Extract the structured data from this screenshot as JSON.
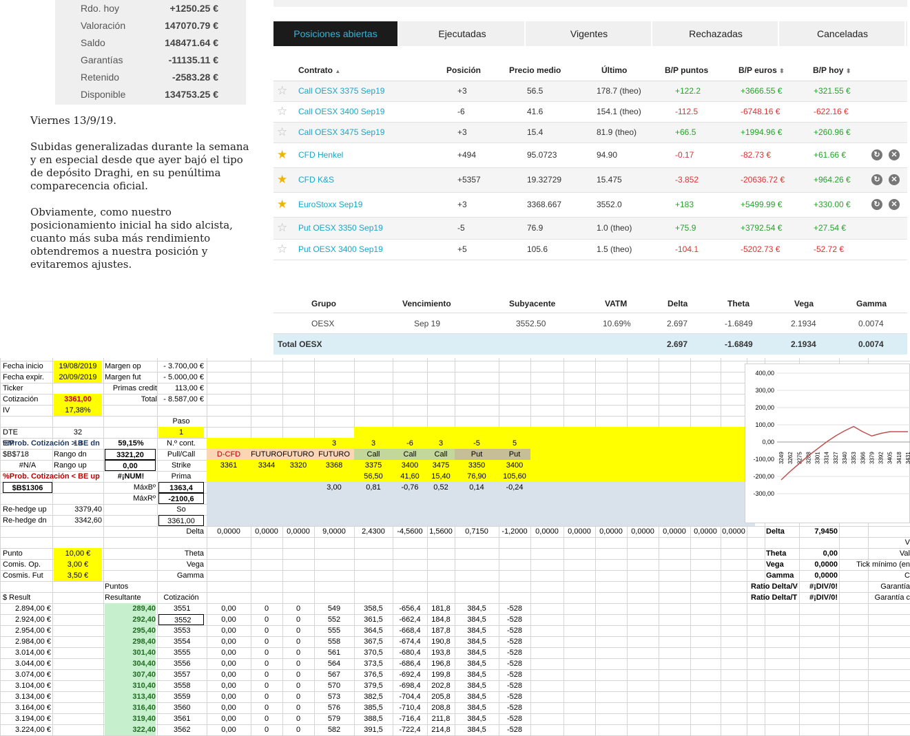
{
  "summary": [
    {
      "label": "Rdo. hoy",
      "value": "+1250.25 €"
    },
    {
      "label": "Valoración",
      "value": "147070.79 €"
    },
    {
      "label": "Saldo",
      "value": "148471.64 €"
    },
    {
      "label": "Garantías",
      "value": "-11135.11 €"
    },
    {
      "label": "Retenido",
      "value": "-2583.28 €"
    },
    {
      "label": "Disponible",
      "value": "134753.25 €"
    }
  ],
  "comment": {
    "p1": "Viernes 13/9/19.",
    "p2": "Subidas generalizadas durante la semana y en especial desde que ayer bajó el tipo de depósito Draghi, en su penúltima comparecencia oficial.",
    "p3": "Obviamente, como nuestro posicionamiento inicial ha sido alcista, cuanto más suba más rendimiento obtendremos a nuestra posición y evitaremos ajustes."
  },
  "tabs": [
    "Posiciones abiertas",
    "Ejecutadas",
    "Vigentes",
    "Rechazadas",
    "Canceladas"
  ],
  "positions": {
    "headers": {
      "contract": "Contrato",
      "position": "Posición",
      "avg": "Precio medio",
      "last": "Último",
      "bp_points": "B/P puntos",
      "bp_euros": "B/P euros",
      "bp_today": "B/P hoy"
    },
    "rows": [
      {
        "fav": false,
        "contract": "Call OESX 3375 Sep19",
        "position": "+3",
        "avg": "56.5",
        "last": "178.7 (theo)",
        "bp_points": "+122.2",
        "bp_euros": "+3666.55 €",
        "bp_today": "+321.55 €"
      },
      {
        "fav": false,
        "contract": "Call OESX 3400 Sep19",
        "position": "-6",
        "avg": "41.6",
        "last": "154.1 (theo)",
        "bp_points": "-112.5",
        "bp_euros": "-6748.16 €",
        "bp_today": "-622.16 €"
      },
      {
        "fav": false,
        "contract": "Call OESX 3475 Sep19",
        "position": "+3",
        "avg": "15.4",
        "last": "81.9 (theo)",
        "bp_points": "+66.5",
        "bp_euros": "+1994.96 €",
        "bp_today": "+260.96 €"
      },
      {
        "fav": true,
        "contract": "CFD Henkel",
        "position": "+494",
        "avg": "95.0723",
        "last": "94.90",
        "bp_points": "-0.17",
        "bp_euros": "-82.73 €",
        "bp_today": "+61.66 €"
      },
      {
        "fav": true,
        "contract": "CFD K&S",
        "position": "+5357",
        "avg": "19.32729",
        "last": "15.475",
        "bp_points": "-3.852",
        "bp_euros": "-20636.72 €",
        "bp_today": "+964.26 €"
      },
      {
        "fav": true,
        "contract": "EuroStoxx Sep19",
        "position": "+3",
        "avg": "3368.667",
        "last": "3552.0",
        "bp_points": "+183",
        "bp_euros": "+5499.99 €",
        "bp_today": "+330.00 €"
      },
      {
        "fav": false,
        "contract": "Put OESX 3350 Sep19",
        "position": "-5",
        "avg": "76.9",
        "last": "1.0 (theo)",
        "bp_points": "+75.9",
        "bp_euros": "+3792.54 €",
        "bp_today": "+27.54 €"
      },
      {
        "fav": false,
        "contract": "Put OESX 3400 Sep19",
        "position": "+5",
        "avg": "105.6",
        "last": "1.5 (theo)",
        "bp_points": "-104.1",
        "bp_euros": "-5202.73 €",
        "bp_today": "-52.72 €"
      }
    ]
  },
  "greeks": {
    "headers": {
      "group": "Grupo",
      "expiry": "Vencimiento",
      "underlying": "Subyacente",
      "vatm": "VATM",
      "delta": "Delta",
      "theta": "Theta",
      "vega": "Vega",
      "gamma": "Gamma"
    },
    "row": {
      "group": "OESX",
      "expiry": "Sep 19",
      "underlying": "3552.50",
      "vatm": "10.69%",
      "delta": "2.697",
      "theta": "-1.6849",
      "vega": "2.1934",
      "gamma": "0.0074"
    },
    "total": {
      "label": "Total OESX",
      "delta": "2.697",
      "theta": "-1.6849",
      "vega": "2.1934",
      "gamma": "0.0074"
    }
  },
  "sheet": {
    "left_labels": [
      {
        "label": "Fecha inicio",
        "value": "19/08/2019"
      },
      {
        "label": "Fecha expir.",
        "value": "20/09/2019"
      },
      {
        "label": "Ticker",
        "value": ""
      },
      {
        "label": "Cotización",
        "value": "3361,00"
      },
      {
        "label": "IV",
        "value": "17,38%"
      },
      {
        "label": "DTE",
        "value": "32"
      },
      {
        "label": "EM",
        "value": "18"
      }
    ],
    "margin": [
      {
        "label": "Margen op",
        "value": "-  3.700,00 €"
      },
      {
        "label": "Margen fut",
        "value": "-  5.000,00 €"
      },
      {
        "label": "Primas credit",
        "value": "113,00 €"
      },
      {
        "label": "Total",
        "value": "-  8.587,00 €"
      }
    ],
    "paso_label": "Paso",
    "paso_value": "1",
    "prob_up_label": "%Prob. Cotización > BE dn",
    "prob_up_value": "59,15%",
    "prob_dn_label": "%Prob. Cotización < BE up",
    "prob_dn_value": "#¡NUM!",
    "ref1": "$B$718",
    "ref2": "#N/A",
    "ref3": "$B$1306",
    "rango_dn_label": "Rango dn",
    "rango_dn_value": "3321,20",
    "rango_up_label": "Rango up",
    "rango_up_value": "0,00",
    "ncont_label": "N.º cont.",
    "pullcall_label": "Pull/Call",
    "strike_label": "Strike",
    "prima_label": "Prima",
    "maxb_label": "MáxBº",
    "maxb_value": "1363,4",
    "maxr_label": "MáxRº",
    "maxr_value": "-2100,6",
    "so_label": "So",
    "so_value": "3361,00",
    "delta_label": "Delta",
    "rehedge_up_label": "Re-hedge up",
    "rehedge_up_value": "3379,40",
    "rehedge_dn_label": "Re-hedge dn",
    "rehedge_dn_value": "3342,60",
    "legs": [
      {
        "n": "",
        "type": "D-CFD",
        "strike": "3361",
        "prima": "",
        "x": ""
      },
      {
        "n": "",
        "type": "FUTURO",
        "strike": "3344",
        "prima": "",
        "x": ""
      },
      {
        "n": "",
        "type": "FUTURO",
        "strike": "3320",
        "prima": "",
        "x": ""
      },
      {
        "n": "3",
        "type": "FUTURO",
        "strike": "3368",
        "prima": "",
        "x": "3,00"
      },
      {
        "n": "3",
        "type": "Call",
        "strike": "3375",
        "prima": "56,50",
        "x": "0,81"
      },
      {
        "n": "-6",
        "type": "Call",
        "strike": "3400",
        "prima": "41,60",
        "x": "-0,76"
      },
      {
        "n": "3",
        "type": "Call",
        "strike": "3475",
        "prima": "15,40",
        "x": "0,52"
      },
      {
        "n": "-5",
        "type": "Put",
        "strike": "3350",
        "prima": "76,90",
        "x": "0,14"
      },
      {
        "n": "5",
        "type": "Put",
        "strike": "3400",
        "prima": "105,60",
        "x": "-0,24"
      }
    ],
    "delta_row": [
      "0,0000",
      "0,0000",
      "0,0000",
      "9,0000",
      "2,4300",
      "-4,5600",
      "1,5600",
      "0,7150",
      "-1,2000",
      "0,0000",
      "0,0000",
      "0,0000",
      "0,0000",
      "0,0000",
      "0,0000",
      "0,0000"
    ],
    "punto": [
      {
        "label": "Punto",
        "value": "10,00 €"
      },
      {
        "label": "Comis. Op.",
        "value": "3,00 €"
      },
      {
        "label": "Cosmis. Fut",
        "value": "3,50 €"
      }
    ],
    "greek_labels": [
      "Theta",
      "Vega",
      "Gamma"
    ],
    "right_stats": [
      {
        "label": "Delta",
        "value": "7,9450"
      },
      {
        "label": "Theta",
        "value": "0,00"
      },
      {
        "label": "Vega",
        "value": "0,0000"
      },
      {
        "label": "Gamma",
        "value": "0,0000"
      },
      {
        "label": "Ratio Delta/Vega",
        "value": "#¡DIV/0!"
      },
      {
        "label": "Ratio Delta/Theta",
        "value": "#¡DIV/0!"
      }
    ],
    "far_right": [
      "V",
      "Val",
      "Tick mínimo (en",
      "C",
      "Garantía",
      "Garantía c"
    ],
    "col_heads": {
      "result": "$ Result",
      "puntos": "Puntos",
      "resultante": "Resultante",
      "cotizacion": "Cotización"
    },
    "result_rows": [
      {
        "result": "2.894,00 €",
        "pts": "289,40",
        "cot": "3551",
        "c": [
          "0,00",
          "0",
          "0",
          "549",
          "358,5",
          "-656,4",
          "181,8",
          "384,5",
          "-528"
        ]
      },
      {
        "result": "2.924,00 €",
        "pts": "292,40",
        "cot": "3552",
        "c": [
          "0,00",
          "0",
          "0",
          "552",
          "361,5",
          "-662,4",
          "184,8",
          "384,5",
          "-528"
        ]
      },
      {
        "result": "2.954,00 €",
        "pts": "295,40",
        "cot": "3553",
        "c": [
          "0,00",
          "0",
          "0",
          "555",
          "364,5",
          "-668,4",
          "187,8",
          "384,5",
          "-528"
        ]
      },
      {
        "result": "2.984,00 €",
        "pts": "298,40",
        "cot": "3554",
        "c": [
          "0,00",
          "0",
          "0",
          "558",
          "367,5",
          "-674,4",
          "190,8",
          "384,5",
          "-528"
        ]
      },
      {
        "result": "3.014,00 €",
        "pts": "301,40",
        "cot": "3555",
        "c": [
          "0,00",
          "0",
          "0",
          "561",
          "370,5",
          "-680,4",
          "193,8",
          "384,5",
          "-528"
        ]
      },
      {
        "result": "3.044,00 €",
        "pts": "304,40",
        "cot": "3556",
        "c": [
          "0,00",
          "0",
          "0",
          "564",
          "373,5",
          "-686,4",
          "196,8",
          "384,5",
          "-528"
        ]
      },
      {
        "result": "3.074,00 €",
        "pts": "307,40",
        "cot": "3557",
        "c": [
          "0,00",
          "0",
          "0",
          "567",
          "376,5",
          "-692,4",
          "199,8",
          "384,5",
          "-528"
        ]
      },
      {
        "result": "3.104,00 €",
        "pts": "310,40",
        "cot": "3558",
        "c": [
          "0,00",
          "0",
          "0",
          "570",
          "379,5",
          "-698,4",
          "202,8",
          "384,5",
          "-528"
        ]
      },
      {
        "result": "3.134,00 €",
        "pts": "313,40",
        "cot": "3559",
        "c": [
          "0,00",
          "0",
          "0",
          "573",
          "382,5",
          "-704,4",
          "205,8",
          "384,5",
          "-528"
        ]
      },
      {
        "result": "3.164,00 €",
        "pts": "316,40",
        "cot": "3560",
        "c": [
          "0,00",
          "0",
          "0",
          "576",
          "385,5",
          "-710,4",
          "208,8",
          "384,5",
          "-528"
        ]
      },
      {
        "result": "3.194,00 €",
        "pts": "319,40",
        "cot": "3561",
        "c": [
          "0,00",
          "0",
          "0",
          "579",
          "388,5",
          "-716,4",
          "211,8",
          "384,5",
          "-528"
        ]
      },
      {
        "result": "3.224,00 €",
        "pts": "322,40",
        "cot": "3562",
        "c": [
          "0,00",
          "0",
          "0",
          "582",
          "391,5",
          "-722,4",
          "214,8",
          "384,5",
          "-528"
        ]
      }
    ],
    "chart": {
      "y_ticks": [
        "400,00",
        "300,00",
        "200,00",
        "100,00",
        "0,00",
        "-100,00",
        "-200,00",
        "-300,00"
      ],
      "x_ticks": [
        "3249",
        "3262",
        "3275",
        "3288",
        "3301",
        "3314",
        "3327",
        "3340",
        "3353",
        "3366",
        "3379",
        "3392",
        "3405",
        "3418",
        "3431"
      ],
      "series": [
        {
          "x": 3249,
          "y": -220
        },
        {
          "x": 3262,
          "y": -170
        },
        {
          "x": 3275,
          "y": -125
        },
        {
          "x": 3288,
          "y": -80
        },
        {
          "x": 3301,
          "y": -40
        },
        {
          "x": 3314,
          "y": 0
        },
        {
          "x": 3327,
          "y": 35
        },
        {
          "x": 3340,
          "y": 65
        },
        {
          "x": 3353,
          "y": 90
        },
        {
          "x": 3366,
          "y": 60
        },
        {
          "x": 3379,
          "y": 35
        },
        {
          "x": 3392,
          "y": 50
        },
        {
          "x": 3405,
          "y": 60
        },
        {
          "x": 3418,
          "y": 60
        },
        {
          "x": 3431,
          "y": 60
        }
      ],
      "color": "#c0504d"
    }
  }
}
